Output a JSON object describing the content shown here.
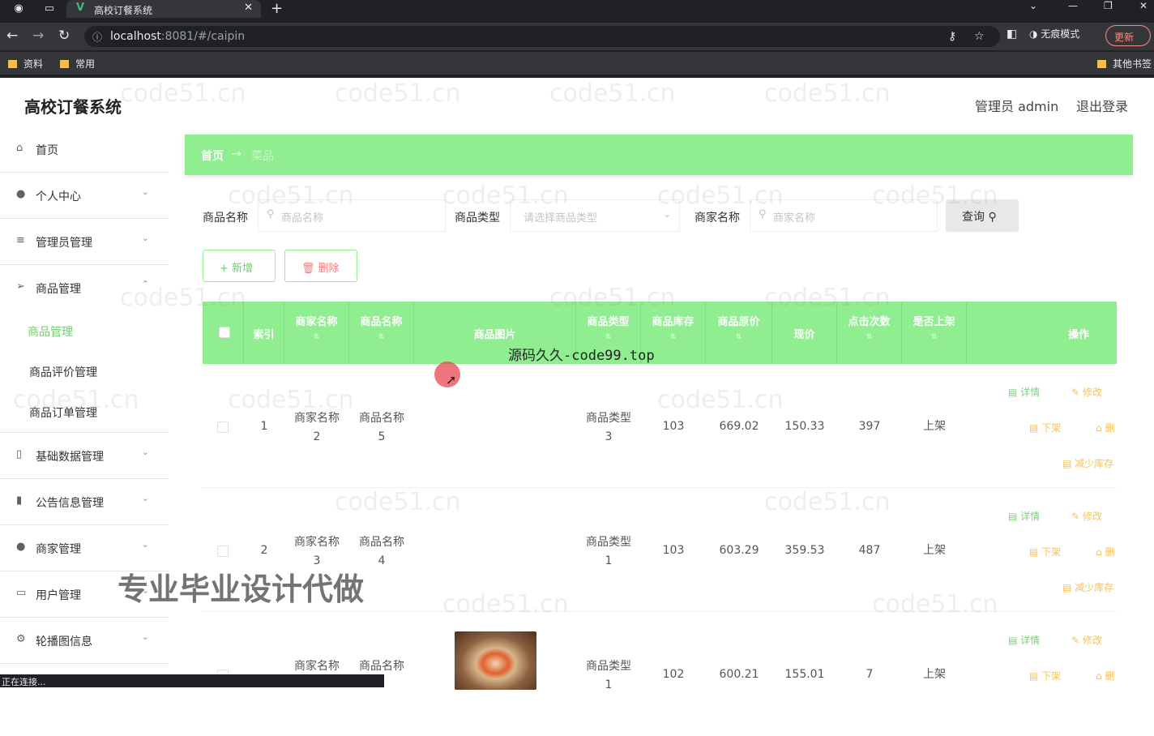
{
  "browser": {
    "tab_title": "高校订餐系统",
    "url_host": "localhost",
    "url_rest": ":8081/#/caipin",
    "incognito_label": "无痕模式",
    "update_label": "更新",
    "bookmarks": [
      "资料",
      "常用"
    ],
    "bookmarks_right": "其他书签",
    "status_text": "正在连接..."
  },
  "header": {
    "app_title": "高校订餐系统",
    "user_label": "管理员 admin",
    "logout_label": "退出登录"
  },
  "sidebar": {
    "items": [
      {
        "label": "首页",
        "icon": "home-icon"
      },
      {
        "label": "个人中心",
        "icon": "user-icon"
      },
      {
        "label": "管理员管理",
        "icon": "list-icon"
      },
      {
        "label": "商品管理",
        "icon": "send-icon"
      },
      {
        "label": "基础数据管理",
        "icon": "data-icon"
      },
      {
        "label": "公告信息管理",
        "icon": "chart-icon"
      },
      {
        "label": "商家管理",
        "icon": "shop-icon"
      },
      {
        "label": "用户管理",
        "icon": "card-icon"
      },
      {
        "label": "轮播图信息",
        "icon": "gear-icon"
      }
    ],
    "sub_items": [
      "商品管理",
      "商品评价管理",
      "商品订单管理"
    ]
  },
  "breadcrumb": {
    "home": "首页",
    "arrow": "→",
    "current": "菜品"
  },
  "filter": {
    "name_label": "商品名称",
    "name_placeholder": "商品名称",
    "type_label": "商品类型",
    "type_placeholder": "请选择商品类型",
    "shop_label": "商家名称",
    "shop_placeholder": "商家名称",
    "query_label": "查询"
  },
  "actions": {
    "add_label": "+ 新增",
    "delete_label": "删除"
  },
  "table": {
    "headers": [
      "索引",
      "商家名称",
      "商品名称",
      "商品图片",
      "商品类型",
      "商品库存",
      "商品原价",
      "现价",
      "点击次数",
      "是否上架",
      "操作"
    ],
    "rows": [
      {
        "index": "1",
        "shop": "商家名称\n2",
        "name": "商品名称\n5",
        "type": "商品类型\n3",
        "stock": "103",
        "orig": "669.02",
        "price": "150.33",
        "clicks": "397",
        "status": "上架"
      },
      {
        "index": "2",
        "shop": "商家名称\n3",
        "name": "商品名称\n4",
        "type": "商品类型\n1",
        "stock": "103",
        "orig": "603.29",
        "price": "359.53",
        "clicks": "487",
        "status": "上架"
      },
      {
        "index": "3",
        "shop": "商家名称",
        "name": "商品名称",
        "type": "商品类型\n1",
        "stock": "102",
        "orig": "600.21",
        "price": "155.01",
        "clicks": "7",
        "status": "上架"
      }
    ],
    "ops": {
      "detail": "详情",
      "edit": "修改",
      "off": "下架",
      "del": "删",
      "reduce": "减少库存"
    }
  },
  "overlays": {
    "center_text": "源码久久-code99.top",
    "promo_text": "专业毕业设计代做",
    "watermark": "code51.cn"
  },
  "colors": {
    "accent": "#90ee90",
    "active": "#6ccf6c",
    "op_green": "#7ccf7c",
    "op_orange": "#f5c35b"
  }
}
